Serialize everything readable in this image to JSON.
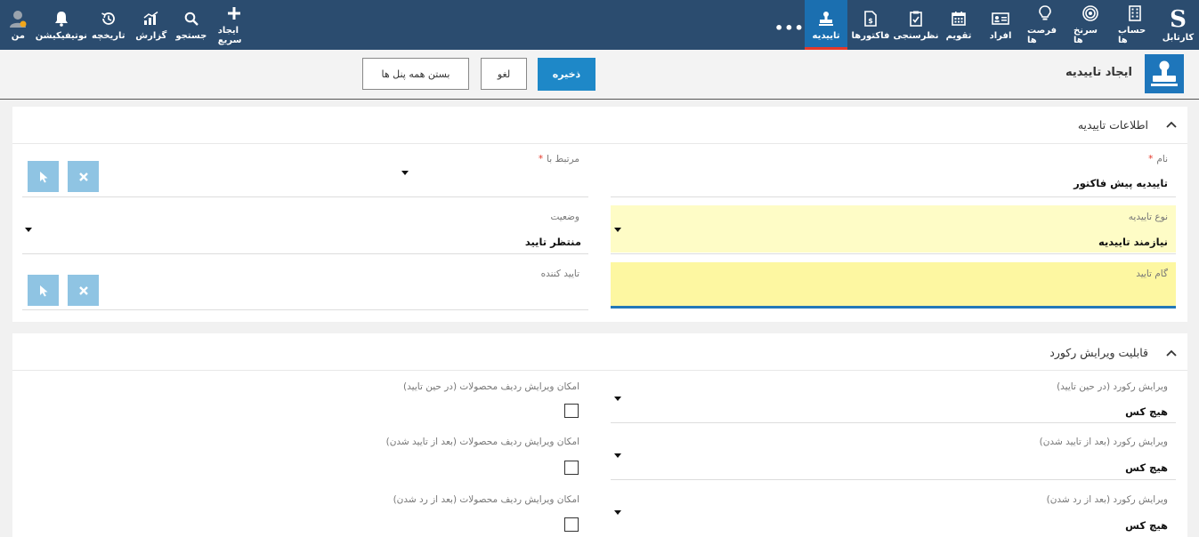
{
  "nav": {
    "logo": "S",
    "logo_label": "کارتابل",
    "items": [
      {
        "label": "حساب ها",
        "icon": "building-icon"
      },
      {
        "label": "سرنخ ها",
        "icon": "target-icon"
      },
      {
        "label": "فرصت ها",
        "icon": "lightbulb-icon"
      },
      {
        "label": "افراد",
        "icon": "contact-card-icon"
      },
      {
        "label": "تقویم",
        "icon": "calendar-icon"
      },
      {
        "label": "نظرسنجی",
        "icon": "clipboard-check-icon"
      },
      {
        "label": "فاکتورها",
        "icon": "invoice-icon"
      },
      {
        "label": "تاییدیه",
        "icon": "stamp-icon",
        "active": true
      }
    ],
    "more": "•••",
    "left_items": [
      {
        "label": "ایجاد سریع",
        "icon": "plus-icon"
      },
      {
        "label": "جستجو",
        "icon": "search-icon"
      },
      {
        "label": "گزارش",
        "icon": "chart-icon"
      },
      {
        "label": "تاریخچه",
        "icon": "history-icon"
      },
      {
        "label": "نوتیفیکیشن",
        "icon": "bell-icon"
      },
      {
        "label": "من",
        "icon": "user-avatar-icon"
      }
    ],
    "active_color": "#1b6fb0",
    "active_underline": "#e5382a"
  },
  "header": {
    "title": "ایجاد تاییدیه",
    "icon": "stamp-icon",
    "save_label": "ذخیره",
    "cancel_label": "لغو",
    "close_panels_label": "بستن همه پنل ها"
  },
  "section1": {
    "title": "اطلاعات تاییدیه",
    "fields": {
      "name_label": "نام",
      "name_value": "تاییدیه پیش فاکتور",
      "related_label": "مرتبط با",
      "type_label": "نوع تاییدیه",
      "type_value": "نیازمند تاییدیه",
      "status_label": "وضعیت",
      "status_value": "منتظر تایید",
      "step_label": "گام تایید",
      "approver_label": "تایید کننده",
      "required_mark": "*"
    }
  },
  "section2": {
    "title": "قابلیت ویرایش رکورد",
    "right_fields": [
      {
        "label": "ویرایش رکورد (در حین تایید)",
        "value": "هیچ کس"
      },
      {
        "label": "ویرایش رکورد (بعد از تایید شدن)",
        "value": "هیچ کس"
      },
      {
        "label": "ویرایش رکورد (بعد از رد شدن)",
        "value": "هیچ کس"
      }
    ],
    "left_checks": [
      {
        "label": "امکان ویرایش ردیف محصولات (در حین تایید)",
        "checked": false
      },
      {
        "label": "امکان ویرایش ردیف محصولات (بعد از تایید شدن)",
        "checked": false
      },
      {
        "label": "امکان ویرایش ردیف محصولات (بعد از رد شدن)",
        "checked": false
      }
    ]
  }
}
